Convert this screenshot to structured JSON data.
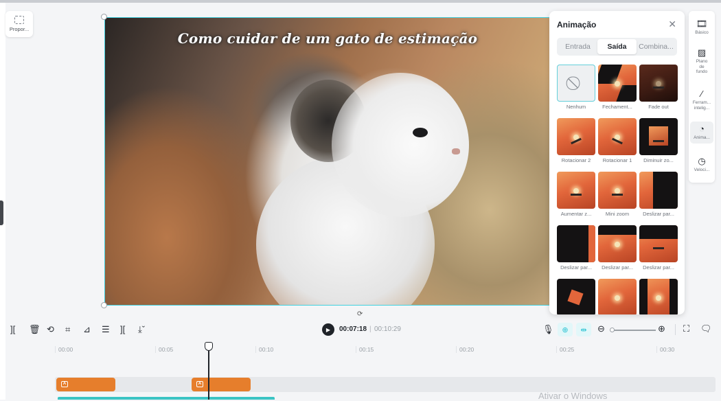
{
  "left_panel": {
    "ratio_label": "Propor..."
  },
  "canvas": {
    "title": "Como cuidar de um gato de estimação"
  },
  "animation_panel": {
    "title": "Animação",
    "tabs": [
      {
        "label": "Entrada",
        "active": false
      },
      {
        "label": "Saída",
        "active": true
      },
      {
        "label": "Combina...",
        "active": false
      }
    ],
    "presets": [
      {
        "label": "Nenhum",
        "selected": true
      },
      {
        "label": "Fechament..."
      },
      {
        "label": "Fade out"
      },
      {
        "label": "Rotacionar 2"
      },
      {
        "label": "Rotacionar 1"
      },
      {
        "label": "Diminuir zo..."
      },
      {
        "label": "Aumentar z..."
      },
      {
        "label": "Mini zoom"
      },
      {
        "label": "Deslizar par..."
      },
      {
        "label": "Deslizar par..."
      },
      {
        "label": "Deslizar par..."
      },
      {
        "label": "Deslizar par..."
      },
      {
        "label": ""
      },
      {
        "label": ""
      },
      {
        "label": ""
      }
    ]
  },
  "right_sidebar": {
    "items": [
      {
        "label": "Básico",
        "icon": "film-icon"
      },
      {
        "label": "Plano de fundo",
        "icon": "background-icon"
      },
      {
        "label": "Ferram... intelig...",
        "icon": "magic-wand-icon"
      },
      {
        "label": "Anima...",
        "icon": "animation-icon",
        "active": true
      },
      {
        "label": "Veloci...",
        "icon": "speed-icon"
      }
    ]
  },
  "playback": {
    "current_time": "00:07:18",
    "separator": "|",
    "total_time": "00:10:29"
  },
  "timeline": {
    "ticks": [
      "00:00",
      "00:05",
      "00:10",
      "00:15",
      "00:20",
      "00:25",
      "00:30"
    ],
    "clip_icon_letter": "A"
  },
  "watermark": "Ativar o Windows",
  "colors": {
    "accent": "#40d1e0",
    "clip": "#e67e2c",
    "text_track": "#3bc4c4"
  }
}
